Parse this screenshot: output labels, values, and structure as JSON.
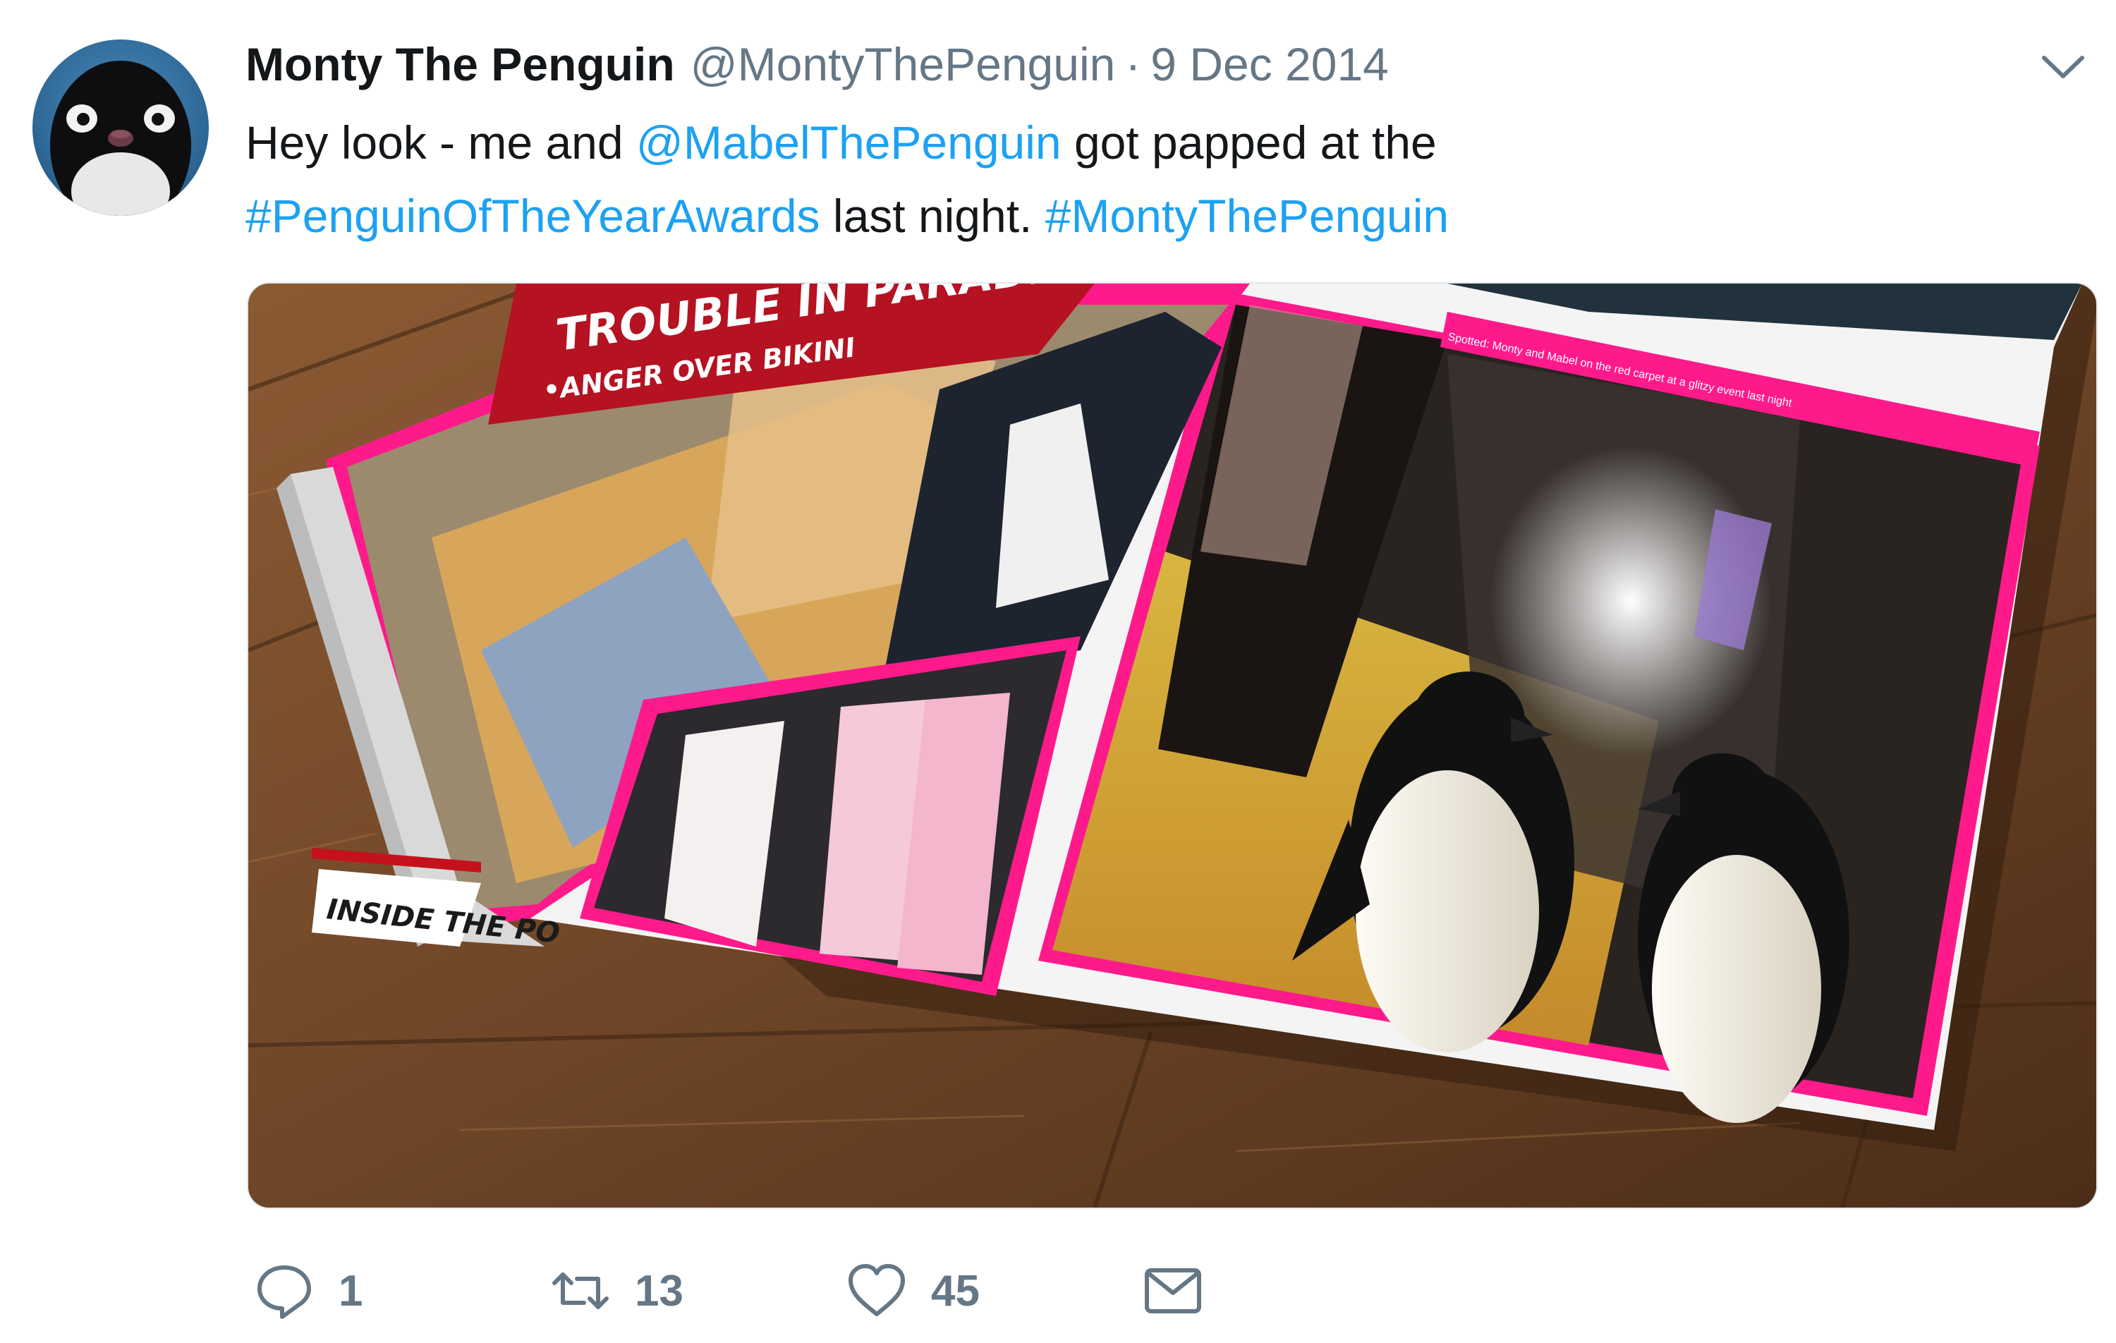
{
  "tweet": {
    "author_name": "Monty The Penguin",
    "author_handle": "@MontyThePenguin",
    "separator": "·",
    "date": "9 Dec 2014",
    "text": {
      "part1": "Hey look - me and ",
      "mention": "@MabelThePenguin",
      "part2": " got papped at the",
      "hashtag1": "#PenguinOfTheYearAwards",
      "part3": " last night. ",
      "hashtag2": "#MontyThePenguin"
    }
  },
  "media": {
    "headline": "TROUBLE IN PARADIS",
    "subhead": "•ANGER OVER BIKINI",
    "side_text": "INSIDE THE PO",
    "caption": "Spotted: Monty and Mabel on the red carpet at a glitzy event last night"
  },
  "actions": {
    "reply_count": "1",
    "retweet_count": "13",
    "like_count": "45"
  },
  "icons": {
    "avatar": "penguin-avatar",
    "caret": "chevron-down-icon",
    "reply": "reply-icon",
    "retweet": "retweet-icon",
    "like": "heart-icon",
    "dm": "envelope-icon"
  },
  "colors": {
    "link": "#1da1f2",
    "secondary_text": "#657786",
    "primary_text": "#14171a",
    "magazine_pink": "#ff1a8c"
  }
}
